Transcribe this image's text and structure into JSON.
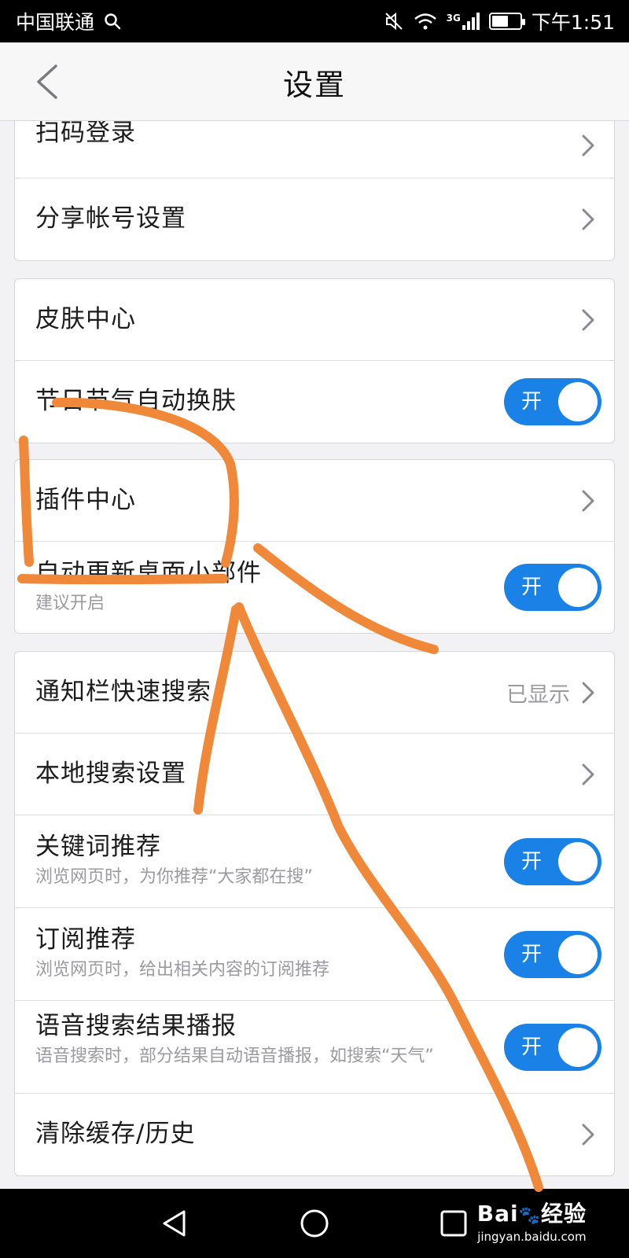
{
  "status_bar": {
    "carrier": "中国联通",
    "network": "3G",
    "time": "下午1:51",
    "battery_level": 0.6
  },
  "header": {
    "title": "设置"
  },
  "groups": [
    {
      "rows": [
        {
          "label": "扫码登录",
          "control": "chevron"
        },
        {
          "label": "分享帐号设置",
          "control": "chevron"
        }
      ]
    },
    {
      "rows": [
        {
          "label": "皮肤中心",
          "control": "chevron"
        },
        {
          "label": "节日节气自动换肤",
          "control": "toggle",
          "toggle_label": "开",
          "on": true
        }
      ]
    },
    {
      "rows": [
        {
          "label": "插件中心",
          "control": "chevron"
        },
        {
          "label": "自动更新桌面小部件",
          "sub": "建议开启",
          "control": "toggle",
          "toggle_label": "开",
          "on": true
        }
      ]
    },
    {
      "rows": [
        {
          "label": "通知栏快速搜索",
          "value": "已显示",
          "control": "chevron"
        },
        {
          "label": "本地搜索设置",
          "control": "chevron"
        },
        {
          "label": "关键词推荐",
          "sub": "浏览网页时，为你推荐“大家都在搜”",
          "control": "toggle",
          "toggle_label": "开",
          "on": true
        },
        {
          "label": "订阅推荐",
          "sub": "浏览网页时，给出相关内容的订阅推荐",
          "control": "toggle",
          "toggle_label": "开",
          "on": true
        },
        {
          "label": "语音搜索结果播报",
          "sub": "语音搜索时，部分结果自动语音播报，如搜索“天气”",
          "control": "toggle",
          "toggle_label": "开",
          "on": true
        },
        {
          "label": "清除缓存/历史",
          "control": "chevron"
        }
      ]
    }
  ],
  "watermark": {
    "brand": "Bai",
    "brand_suffix": "经验",
    "url": "jingyan.baidu.com"
  },
  "colors": {
    "toggle_on": "#1a82e6",
    "annotation": "#f0883a"
  }
}
